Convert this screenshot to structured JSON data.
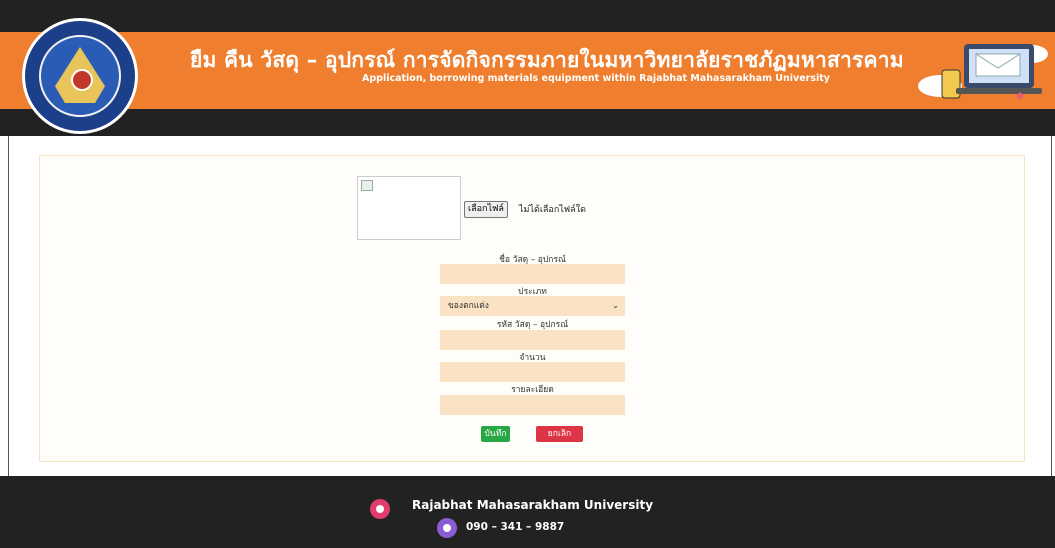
{
  "header": {
    "title_th": "ยืม คืน วัสดุ – อุปกรณ์ การจัดกิจกรรมภายในมหาวิทยาลัยราชภัฏมหาสารคาม",
    "title_en": "Application, borrowing materials equipment within Rajabhat Mahasarakham University"
  },
  "form": {
    "file_button": "เลือกไฟล์",
    "file_status": "ไม่ได้เลือกไฟล์ใด",
    "name_label": "ชื่อ วัสดุ – อุปกรณ์",
    "type_label": "ประเภท",
    "type_selected": "ของตกแต่ง",
    "code_label": "รหัส วัสดุ – อุปกรณ์",
    "qty_label": "จำนวน",
    "detail_label": "รายละเอียด",
    "save_label": "บันทึก",
    "cancel_label": "ยกเลิก"
  },
  "footer": {
    "university": "Rajabhat Mahasarakham University",
    "phone": "090 – 341 – 9887"
  },
  "colors": {
    "banner": "#ef7f2e",
    "dark": "#222222",
    "field_bg": "#fae3c4",
    "save": "#28a745",
    "cancel": "#dc3545"
  }
}
